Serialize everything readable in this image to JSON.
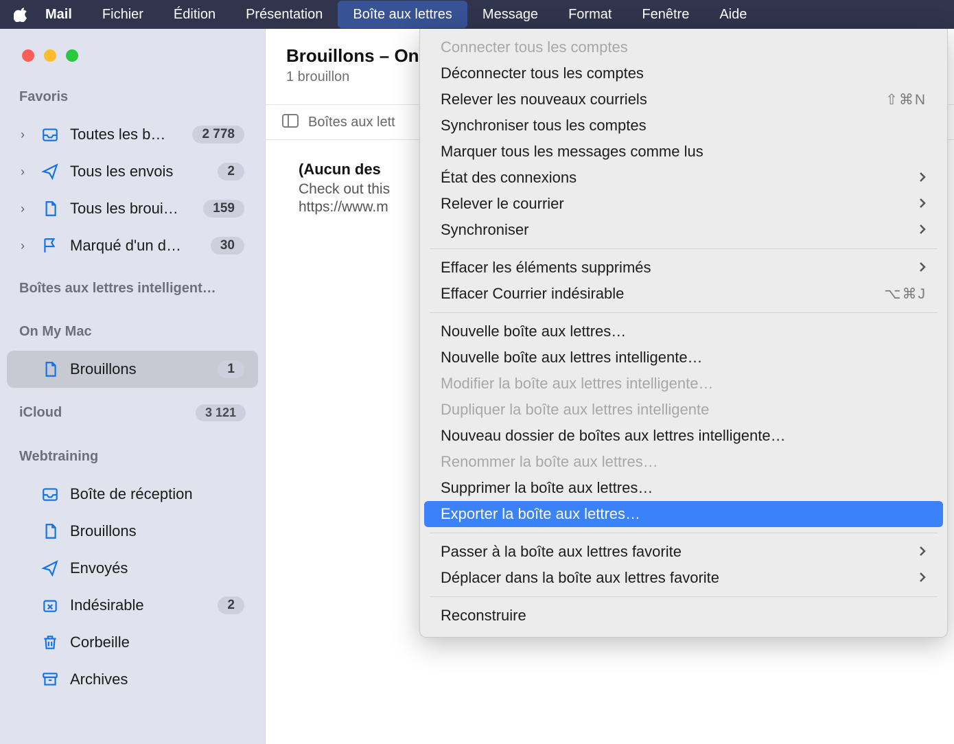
{
  "menubar": {
    "app": "Mail",
    "items": [
      "Fichier",
      "Édition",
      "Présentation",
      "Boîte aux lettres",
      "Message",
      "Format",
      "Fenêtre",
      "Aide"
    ],
    "active_index": 3
  },
  "sidebar": {
    "favorites_label": "Favoris",
    "favorites": [
      {
        "label": "Toutes les b…",
        "count": "2 778",
        "icon": "inbox",
        "disclosure": true
      },
      {
        "label": "Tous les envois",
        "count": "2",
        "icon": "sent",
        "disclosure": true
      },
      {
        "label": "Tous les broui…",
        "count": "159",
        "icon": "draft",
        "disclosure": true
      },
      {
        "label": "Marqué d'un d…",
        "count": "30",
        "icon": "flag",
        "disclosure": true
      }
    ],
    "smart_label": "Boîtes aux lettres intelligent…",
    "onmymac_label": "On My Mac",
    "onmymac": [
      {
        "label": "Brouillons",
        "count": "1",
        "icon": "draft",
        "selected": true
      }
    ],
    "icloud_label": "iCloud",
    "icloud_count": "3 121",
    "webtraining_label": "Webtraining",
    "webtraining": [
      {
        "label": "Boîte de réception",
        "icon": "inbox"
      },
      {
        "label": "Brouillons",
        "icon": "draft"
      },
      {
        "label": "Envoyés",
        "icon": "sent"
      },
      {
        "label": "Indésirable",
        "count": "2",
        "icon": "junk"
      },
      {
        "label": "Corbeille",
        "icon": "trash"
      },
      {
        "label": "Archives",
        "icon": "archive"
      }
    ]
  },
  "content": {
    "title": "Brouillons – On",
    "subtitle": "1 brouillon",
    "bar_text": "Boîtes aux lett",
    "message": {
      "subject": "(Aucun des",
      "snippet": "Check out this",
      "link": "https://www.m"
    }
  },
  "dropdown": {
    "items": [
      {
        "label": "Connecter tous les comptes",
        "disabled": true
      },
      {
        "label": "Déconnecter tous les comptes"
      },
      {
        "label": "Relever les nouveaux courriels",
        "shortcut": "⇧⌘N"
      },
      {
        "label": "Synchroniser tous les comptes"
      },
      {
        "label": "Marquer tous les messages comme lus"
      },
      {
        "label": "État des connexions",
        "submenu": true
      },
      {
        "label": "Relever le courrier",
        "submenu": true
      },
      {
        "label": "Synchroniser",
        "submenu": true
      },
      {
        "sep": true
      },
      {
        "label": "Effacer les éléments supprimés",
        "submenu": true
      },
      {
        "label": "Effacer Courrier indésirable",
        "shortcut": "⌥⌘J"
      },
      {
        "sep": true
      },
      {
        "label": "Nouvelle boîte aux lettres…"
      },
      {
        "label": "Nouvelle boîte aux lettres intelligente…"
      },
      {
        "label": "Modifier la boîte aux lettres intelligente…",
        "disabled": true
      },
      {
        "label": "Dupliquer la boîte aux lettres intelligente",
        "disabled": true
      },
      {
        "label": "Nouveau dossier de boîtes aux lettres intelligente…"
      },
      {
        "label": "Renommer la boîte aux lettres…",
        "disabled": true
      },
      {
        "label": "Supprimer la boîte aux lettres…"
      },
      {
        "label": "Exporter la boîte aux lettres…",
        "highlight": true
      },
      {
        "sep": true
      },
      {
        "label": "Passer à la boîte aux lettres favorite",
        "submenu": true
      },
      {
        "label": "Déplacer dans la boîte aux lettres favorite",
        "submenu": true
      },
      {
        "sep": true
      },
      {
        "label": "Reconstruire"
      }
    ]
  }
}
